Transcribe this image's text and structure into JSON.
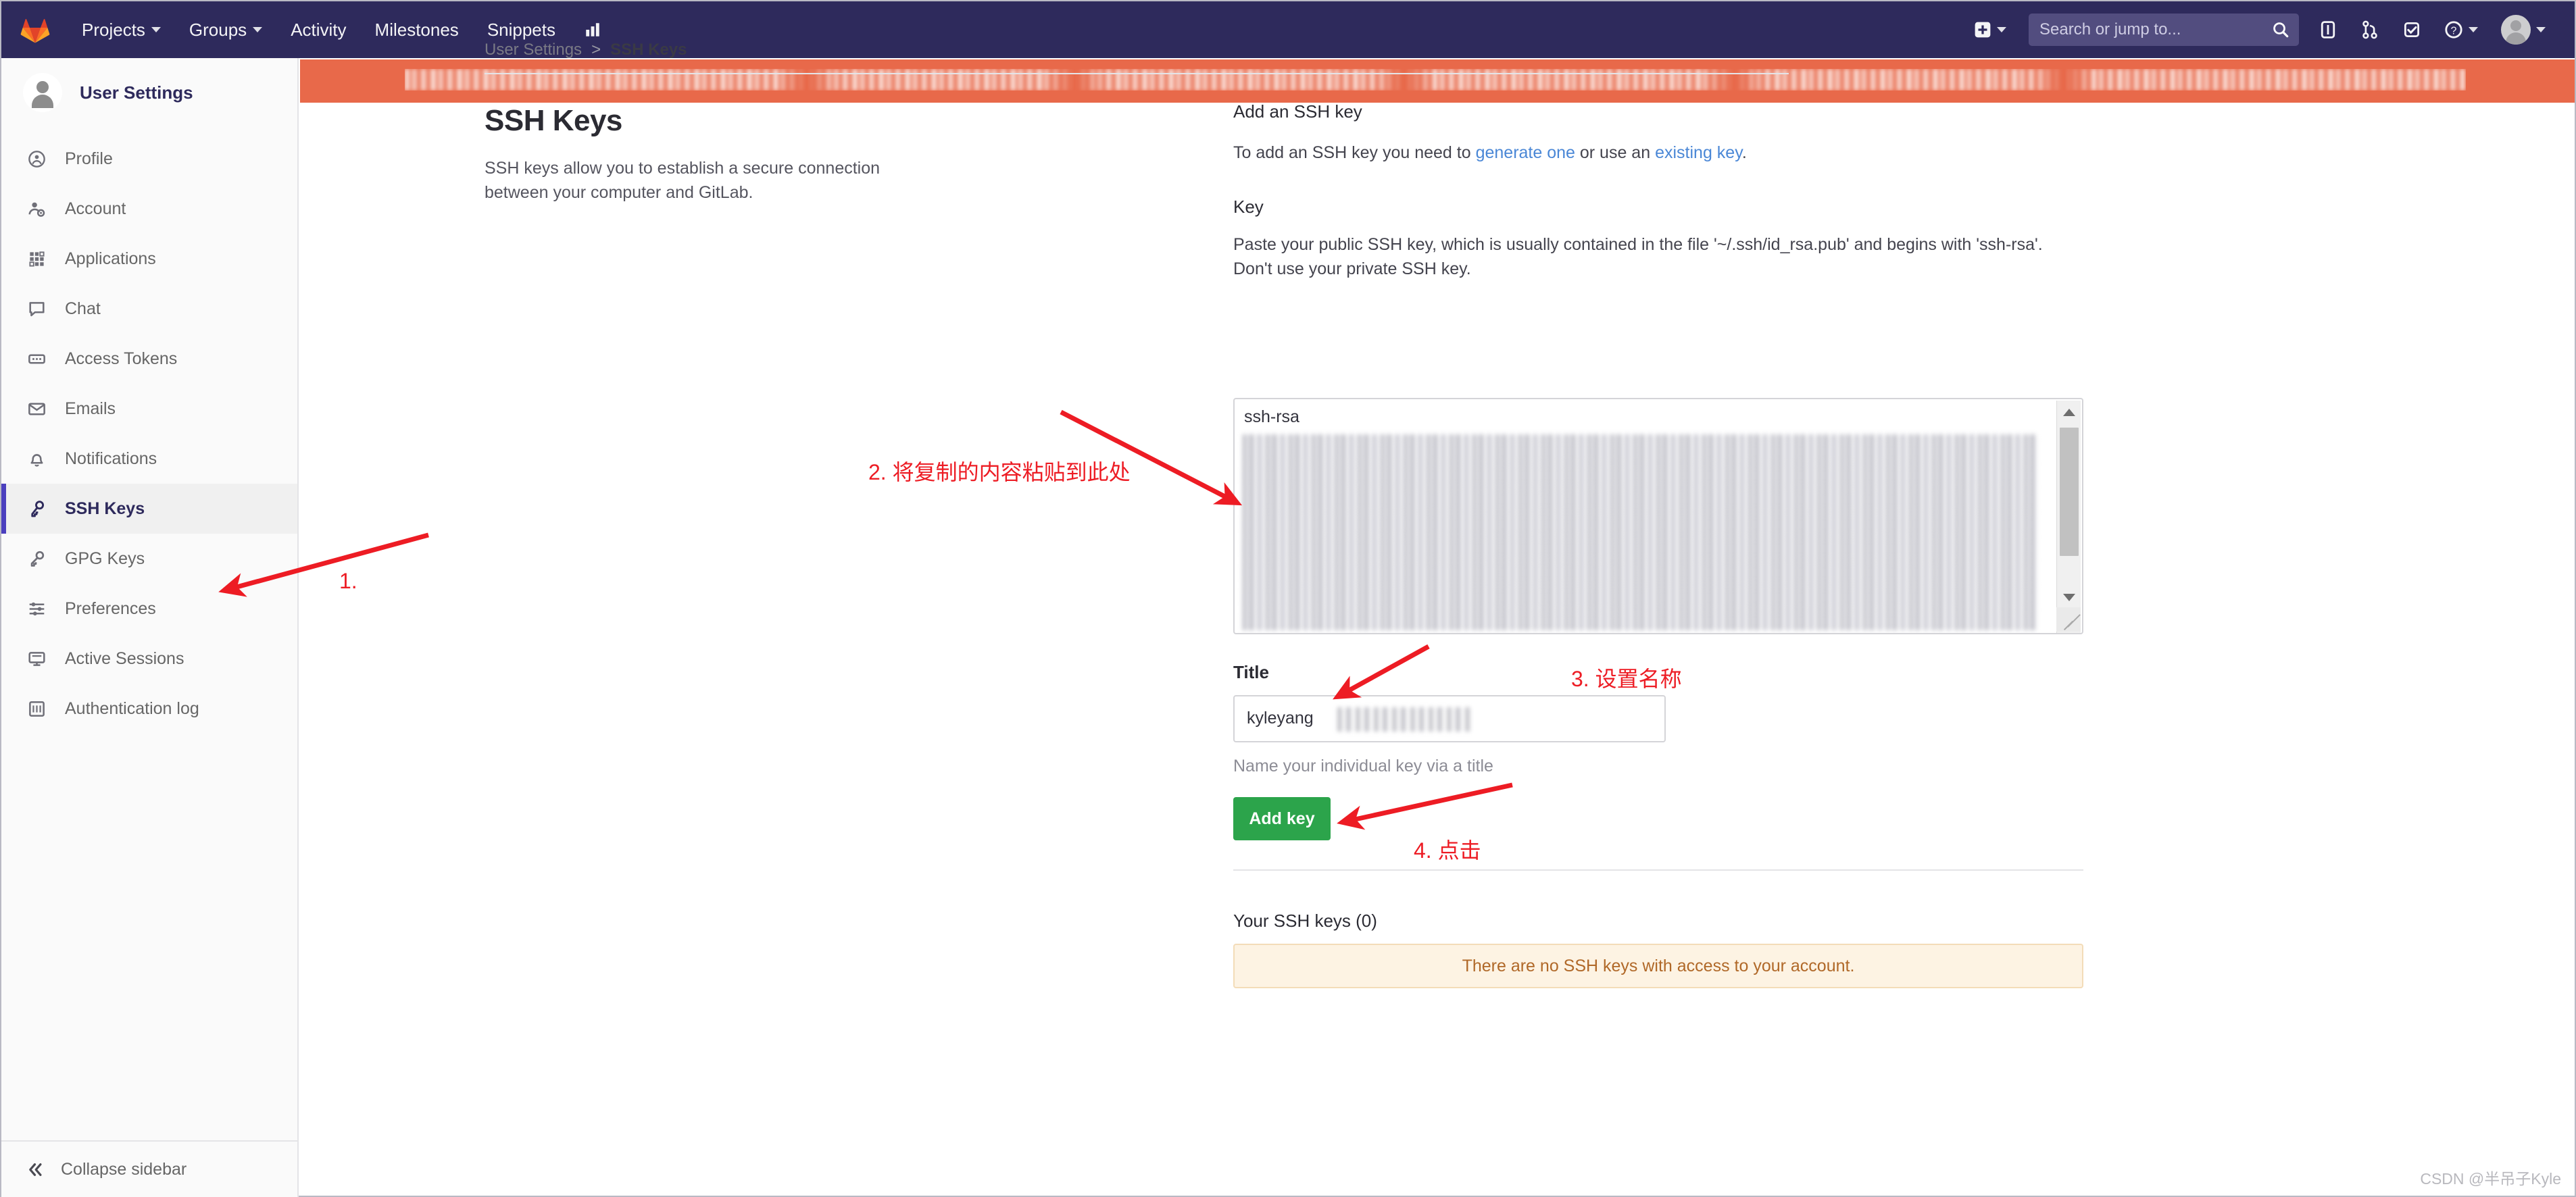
{
  "navbar": {
    "logo_icon": "gitlab-tanuki-logo",
    "links": [
      {
        "label": "Projects",
        "caret": true
      },
      {
        "label": "Groups",
        "caret": true
      },
      {
        "label": "Activity",
        "caret": false
      },
      {
        "label": "Milestones",
        "caret": false
      },
      {
        "label": "Snippets",
        "caret": false
      }
    ],
    "analytics_icon": "chart-bar-icon",
    "plus_icon": "plus-square-icon",
    "search": {
      "placeholder": "Search or jump to...",
      "icon": "search-icon"
    },
    "icons": [
      {
        "name": "issues-icon"
      },
      {
        "name": "merge-requests-icon"
      },
      {
        "name": "todos-icon"
      },
      {
        "name": "help-icon"
      }
    ],
    "avatar_icon": "user-avatar",
    "background_color": "#2e2a5c"
  },
  "sidebar": {
    "header_title": "User Settings",
    "avatar_icon": "user-avatar-large",
    "items": [
      {
        "label": "Profile",
        "icon": "profile-circle-icon",
        "active": false
      },
      {
        "label": "Account",
        "icon": "account-gear-icon",
        "active": false
      },
      {
        "label": "Applications",
        "icon": "applications-grid-icon",
        "active": false
      },
      {
        "label": "Chat",
        "icon": "chat-bubble-icon",
        "active": false
      },
      {
        "label": "Access Tokens",
        "icon": "token-icon",
        "active": false
      },
      {
        "label": "Emails",
        "icon": "envelope-icon",
        "active": false
      },
      {
        "label": "Notifications",
        "icon": "bell-icon",
        "active": false
      },
      {
        "label": "SSH Keys",
        "icon": "key-icon",
        "active": true
      },
      {
        "label": "GPG Keys",
        "icon": "gpg-key-icon",
        "active": false
      },
      {
        "label": "Preferences",
        "icon": "sliders-icon",
        "active": false
      },
      {
        "label": "Active Sessions",
        "icon": "monitor-icon",
        "active": false
      },
      {
        "label": "Authentication log",
        "icon": "log-grid-icon",
        "active": false
      }
    ],
    "collapse_label": "Collapse sidebar",
    "collapse_icon": "chevron-double-left-icon",
    "active_accent_color": "#4b3fbe"
  },
  "banner": {
    "visible": true,
    "background_color": "#e8694a",
    "text_redacted": true
  },
  "breadcrumb": {
    "root": "User Settings",
    "separator": ">",
    "current": "SSH Keys"
  },
  "left_panel": {
    "heading": "SSH Keys",
    "description": "SSH keys allow you to establish a secure connection between your computer and GitLab."
  },
  "right_panel": {
    "section_title": "Add an SSH key",
    "intro_prefix": "To add an SSH key you need to ",
    "link_generate": "generate one",
    "intro_middle": " or use an ",
    "link_existing": "existing key",
    "intro_suffix": ".",
    "key_label": "Key",
    "key_help": "Paste your public SSH key, which is usually contained in the file '~/.ssh/id_rsa.pub' and begins with 'ssh-rsa'. Don't use your private SSH key.",
    "key_textarea_value": "ssh-rsa",
    "key_textarea_redacted": true,
    "title_label": "Title",
    "title_value": "kyleyang",
    "title_value_redacted": true,
    "title_help": "Name your individual key via a title",
    "add_key_button": "Add key",
    "add_key_color": "#2ca44b",
    "keys_heading": "Your SSH keys (0)",
    "empty_message": "There are no SSH keys with access to your account.",
    "empty_bg_color": "#fdf3e3",
    "empty_text_color": "#b06828"
  },
  "annotations": {
    "color": "#ed1c24",
    "step1": "1.",
    "step2": "2. 将复制的内容粘贴到此处",
    "step3": "3. 设置名称",
    "step4": "4. 点击"
  },
  "watermark": "CSDN @半吊子Kyle"
}
